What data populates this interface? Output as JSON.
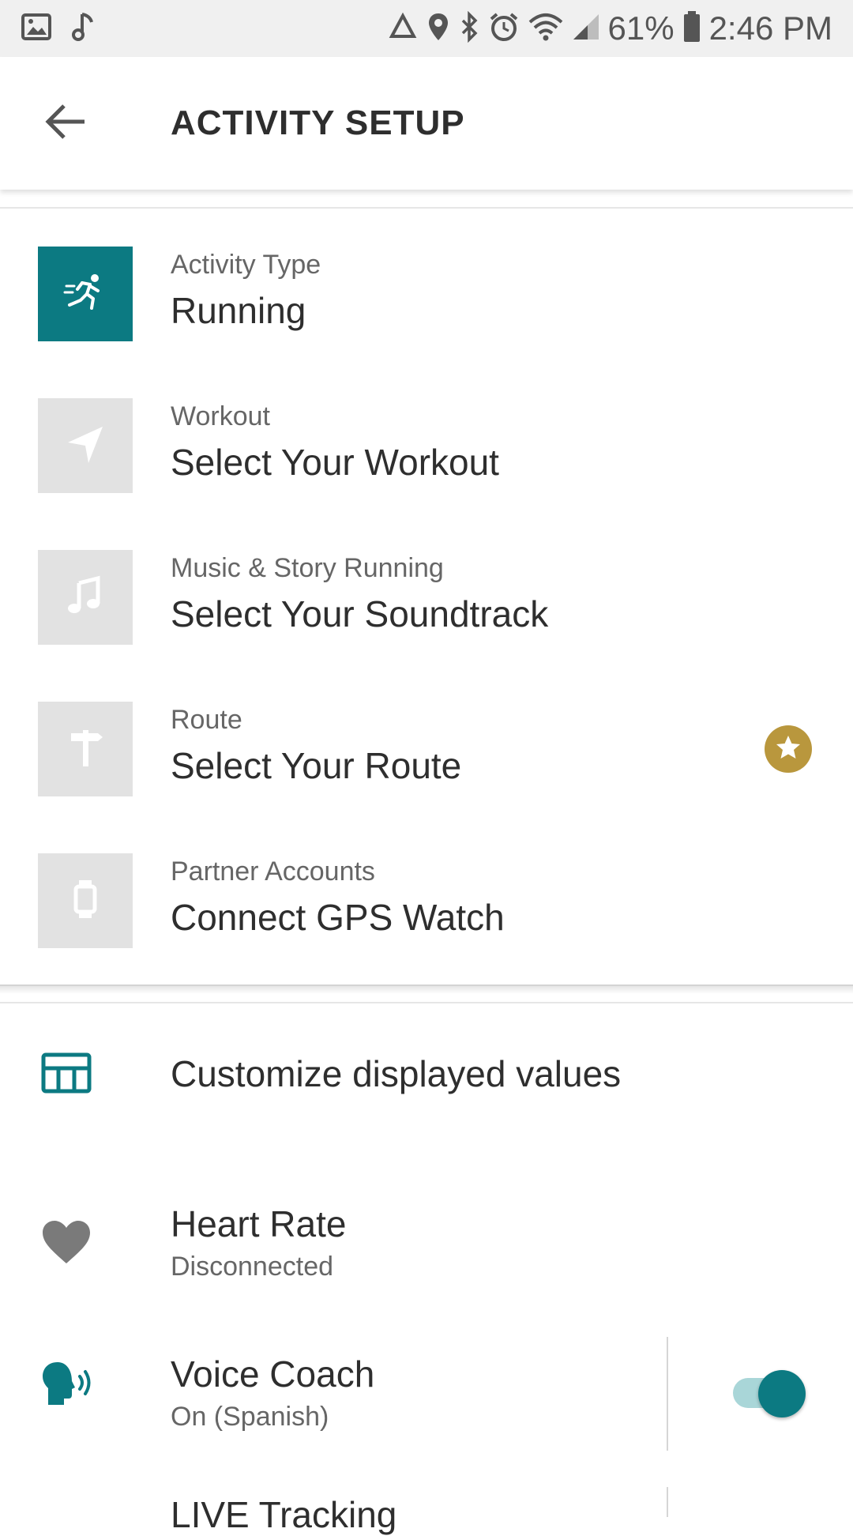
{
  "status_bar": {
    "battery_percent": "61%",
    "time": "2:46 PM",
    "icons_left": [
      "image-icon",
      "music-note-icon"
    ],
    "icons_right": [
      "recycle-icon",
      "location-icon",
      "bluetooth-icon",
      "alarm-icon",
      "wifi-icon",
      "signal-icon",
      "battery-icon"
    ]
  },
  "app_bar": {
    "title": "ACTIVITY SETUP",
    "back_icon": "arrow-back-icon"
  },
  "setup_items": [
    {
      "label": "Activity Type",
      "value": "Running",
      "icon": "runner-icon",
      "active": true
    },
    {
      "label": "Workout",
      "value": "Select Your Workout",
      "icon": "navigation-arrow-icon",
      "active": false
    },
    {
      "label": "Music & Story Running",
      "value": "Select Your Soundtrack",
      "icon": "music-note-icon",
      "active": false
    },
    {
      "label": "Route",
      "value": "Select Your Route",
      "icon": "signpost-icon",
      "active": false,
      "badge": "star-icon"
    },
    {
      "label": "Partner Accounts",
      "value": "Connect GPS Watch",
      "icon": "watch-icon",
      "active": false
    }
  ],
  "settings": {
    "customize": {
      "label": "Customize displayed values",
      "icon": "dashboard-icon"
    },
    "heart_rate": {
      "label": "Heart Rate",
      "status": "Disconnected",
      "icon": "heart-icon"
    },
    "voice_coach": {
      "label": "Voice Coach",
      "status": "On (Spanish)",
      "icon": "voice-icon",
      "enabled": true
    },
    "partial_item": {
      "label": "LIVE Tracking"
    }
  },
  "colors": {
    "accent": "#0c7a82",
    "tile_inactive": "#e2e2e2",
    "badge_gold": "#b9973d",
    "toggle_track": "#a9d6d8"
  }
}
